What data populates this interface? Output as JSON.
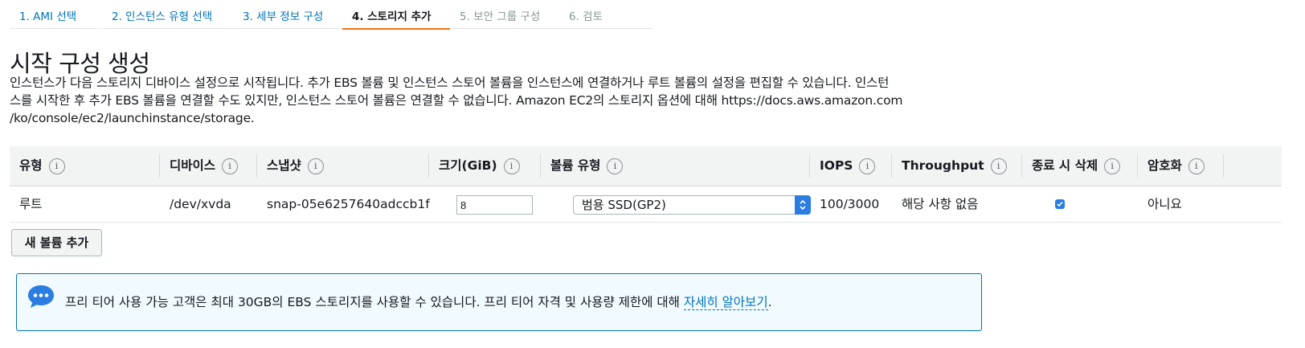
{
  "tabs": [
    {
      "label": "1. AMI 선택",
      "state": "link"
    },
    {
      "label": "2. 인스턴스 유형 선택",
      "state": "link"
    },
    {
      "label": "3. 세부 정보 구성",
      "state": "link"
    },
    {
      "label": "4. 스토리지 추가",
      "state": "active"
    },
    {
      "label": "5. 보안 그룹 구성",
      "state": "disabled"
    },
    {
      "label": "6. 검토",
      "state": "disabled"
    }
  ],
  "page": {
    "title": "시작 구성 생성",
    "description_line1": "인스턴스가 다음 스토리지 디바이스 설정으로 시작됩니다. 추가 EBS 볼륨 및 인스턴스 스토어 볼륨을 인스턴스에 연결하거나 루트 볼륨의 설정을 편집할 수 있습니다. 인스턴",
    "description_line2": "스를 시작한 후 추가 EBS 볼륨을 연결할 수도 있지만, 인스턴스 스토어 볼륨은 연결할 수 없습니다. Amazon EC2의 스토리지 옵션에 대해 https://docs.aws.amazon.com",
    "description_line3": "/ko/console/ec2/launchinstance/storage."
  },
  "table": {
    "headers": {
      "type": "유형",
      "device": "디바이스",
      "snapshot": "스냅샷",
      "size": "크기(GiB)",
      "volume_type": "볼륨 유형",
      "iops": "IOPS",
      "throughput": "Throughput",
      "delete_on_termination": "종료 시 삭제",
      "encryption": "암호화"
    },
    "info_symbol": "i",
    "row": {
      "type": "루트",
      "device": "/dev/xvda",
      "snapshot": "snap-05e6257640adccb1f",
      "size": "8",
      "volume_type": "범용 SSD(GP2)",
      "iops": "100/3000",
      "throughput": "해당 사항 없음",
      "delete_on_termination": true,
      "encryption": "아니요"
    }
  },
  "actions": {
    "add_volume_label": "새 볼륨 추가"
  },
  "alert": {
    "icon": "chat-bubble-icon",
    "text": "프리 티어 사용 가능 고객은 최대 30GB의 EBS 스토리지를 사용할 수 있습니다. 프리 티어 자격 및 사용량 제한에 대해 ",
    "link_label": "자세히 알아보기",
    "suffix": "."
  },
  "colors": {
    "link": "#0073bb",
    "active_tab_underline": "#ec7211",
    "header_bg": "#f2f3f3",
    "alert_bg": "#f1faff",
    "control_blue": "#2a7de1"
  }
}
